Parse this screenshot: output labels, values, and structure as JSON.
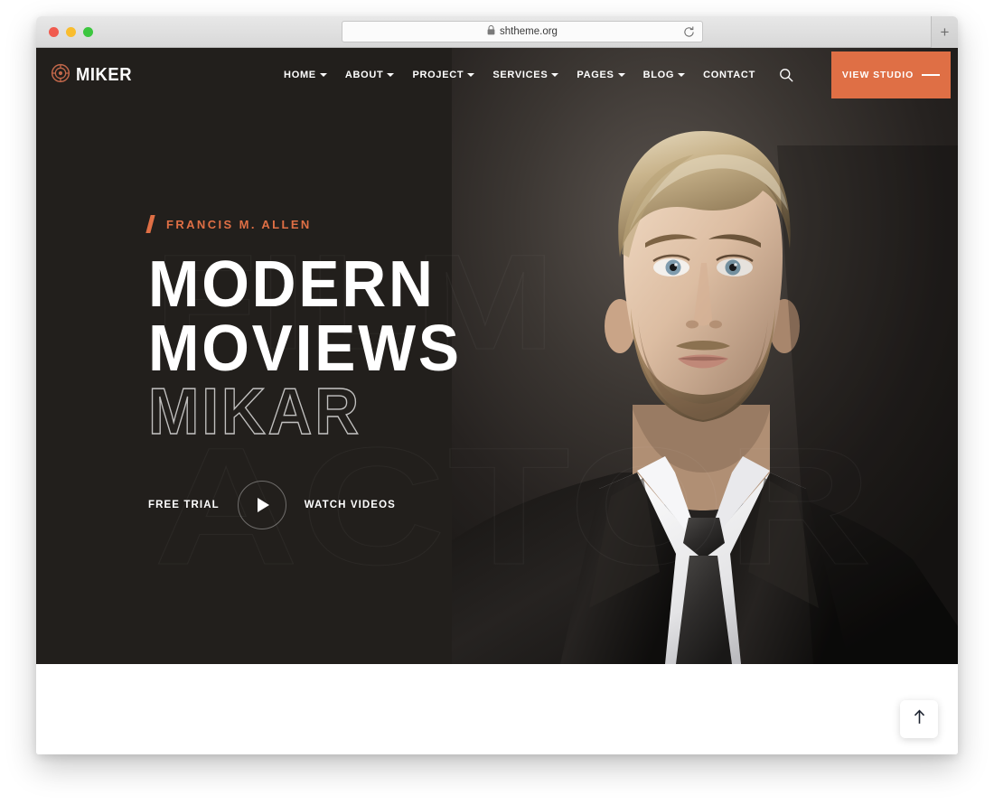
{
  "browser": {
    "url": "shtheme.org",
    "lock_icon": "lock-icon",
    "reload_icon": "reload-icon",
    "newtab_label": "+",
    "traffic_lights": [
      "close",
      "minimize",
      "maximize"
    ]
  },
  "site": {
    "logo": {
      "icon": "film-reel-icon",
      "text": "MIKER"
    },
    "nav": [
      {
        "label": "HOME",
        "has_dropdown": true
      },
      {
        "label": "ABOUT",
        "has_dropdown": true
      },
      {
        "label": "PROJECT",
        "has_dropdown": true
      },
      {
        "label": "SERVICES",
        "has_dropdown": true
      },
      {
        "label": "PAGES",
        "has_dropdown": true
      },
      {
        "label": "BLOG",
        "has_dropdown": true
      },
      {
        "label": "CONTACT",
        "has_dropdown": false
      }
    ],
    "search_icon": "search-icon",
    "cta": {
      "label": "VIEW STUDIO"
    }
  },
  "hero": {
    "eyebrow": "FRANCIS M. ALLEN",
    "headline_line1": "MODERN",
    "headline_line2": "MOVIEWS",
    "headline_line3": "MIKAR",
    "watermark_top": "FILM",
    "watermark_bottom": "ACTOR",
    "actions": {
      "left_label": "FREE TRIAL",
      "play_icon": "play-icon",
      "right_label": "WATCH VIDEOS"
    },
    "photo_alt": "portrait-of-man-in-dark-suit"
  },
  "footer_widgets": {
    "scroll_top_icon": "arrow-up-icon"
  },
  "colors": {
    "accent": "#df6f45",
    "hero_background": "#221f1c",
    "text_light": "#ffffff"
  }
}
